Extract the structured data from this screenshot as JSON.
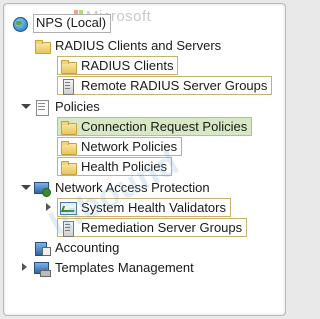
{
  "watermark": {
    "brand": "Microsoft",
    "diagonal": "Inbound"
  },
  "tree": {
    "root": {
      "label": "NPS (Local)"
    },
    "radius_clients_servers": {
      "label": "RADIUS Clients and Servers",
      "children": [
        {
          "label": "RADIUS Clients"
        },
        {
          "label": "Remote RADIUS Server Groups"
        }
      ]
    },
    "policies": {
      "label": "Policies",
      "children": [
        {
          "label": "Connection Request Policies",
          "selected": true
        },
        {
          "label": "Network Policies"
        },
        {
          "label": "Health Policies"
        }
      ]
    },
    "nap": {
      "label": "Network Access Protection",
      "children": [
        {
          "label": "System Health Validators"
        },
        {
          "label": "Remediation Server Groups"
        }
      ]
    },
    "accounting": {
      "label": "Accounting"
    },
    "templates": {
      "label": "Templates Management"
    }
  },
  "colors": {
    "selected_bg": "#d7e8c4",
    "box_border": "#c9b36a"
  }
}
